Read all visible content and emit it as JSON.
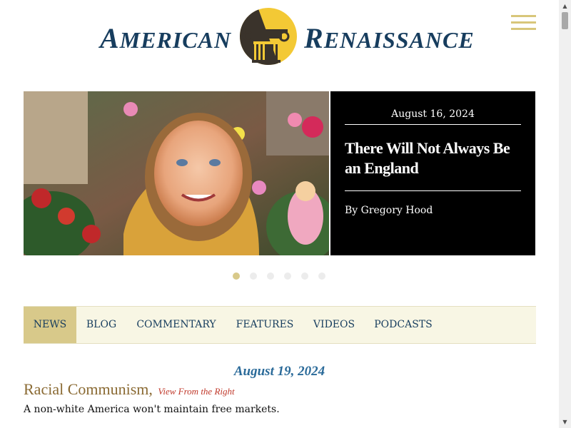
{
  "header": {
    "brand_left_initial": "A",
    "brand_left_rest": "MERICAN",
    "brand_right_initial": "R",
    "brand_right_rest": "ENAISSANCE",
    "logo_icon": "ionic-column-icon",
    "menu_icon": "hamburger-menu-icon"
  },
  "hero": {
    "date": "August 16, 2024",
    "title": "There Will Not Always Be an England",
    "author": "By Gregory Hood",
    "image_icon": "memorial-photo"
  },
  "carousel": {
    "count": 6,
    "active_index": 0
  },
  "nav": {
    "items": [
      "NEWS",
      "BLOG",
      "COMMENTARY",
      "FEATURES",
      "VIDEOS",
      "PODCASTS"
    ],
    "active": "NEWS"
  },
  "article": {
    "date": "August 19, 2024",
    "title": "Racial Communism,",
    "source": "View From the Right",
    "summary": "A non-white America won't maintain free markets."
  },
  "colors": {
    "brand_navy": "#173d5e",
    "logo_gold": "#f3c935",
    "logo_dark": "#3a332b",
    "accent_gold": "#d8c98a",
    "nav_bg": "#f8f6e4",
    "date_blue": "#2a6a99",
    "title_brown": "#8a6a33",
    "source_red": "#c0392b"
  }
}
